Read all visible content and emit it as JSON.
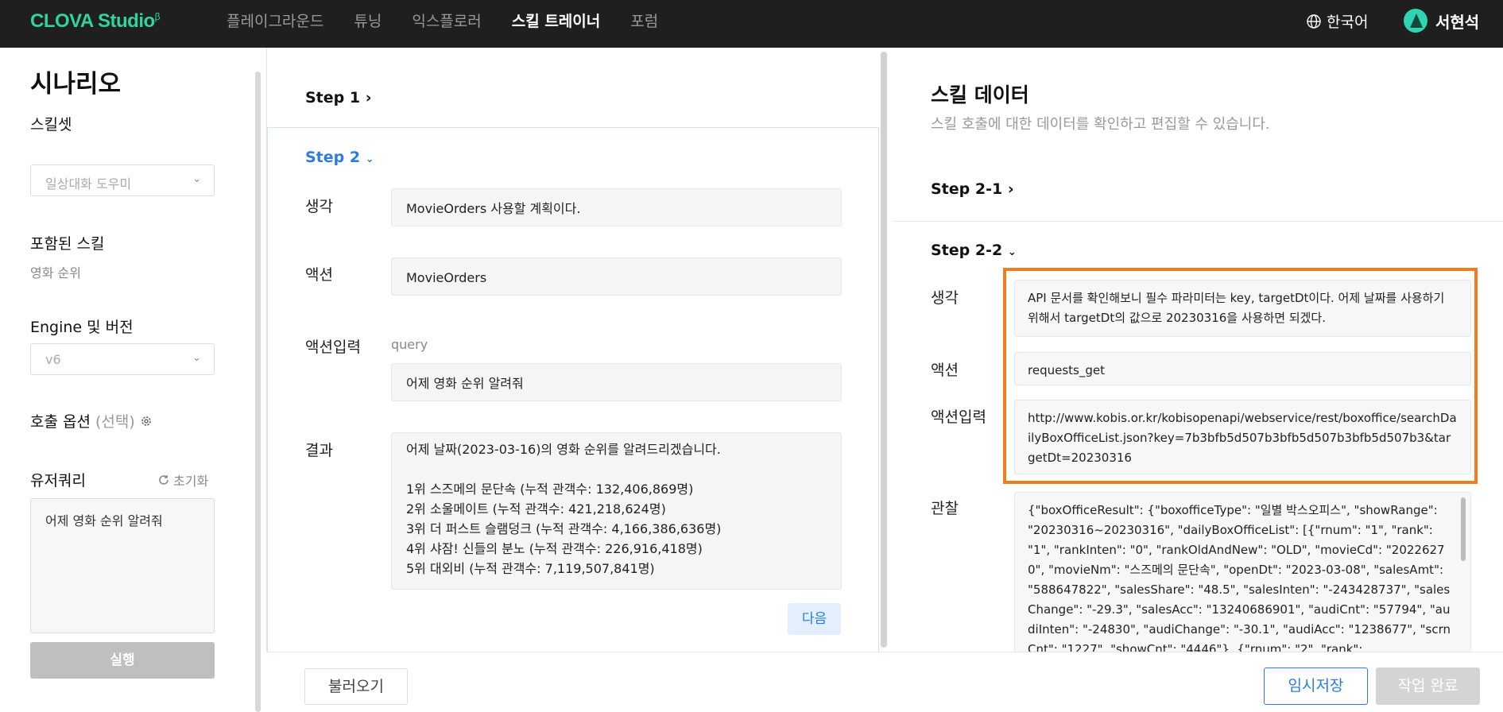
{
  "brand": {
    "name": "CLOVA Studio",
    "beta": "β"
  },
  "nav": {
    "items": [
      "플레이그라운드",
      "튜닝",
      "익스플로러",
      "스킬 트레이너",
      "포럼"
    ],
    "active_index": 3
  },
  "header": {
    "language": "한국어",
    "user": "서현석"
  },
  "sidebar": {
    "title": "시나리오",
    "skillset_label": "스킬셋",
    "skillset_value": "일상대화 도우미",
    "included_skills_label": "포함된 스킬",
    "included_skills_value": "영화 순위",
    "engine_label": "Engine 및 버전",
    "engine_value": "v6",
    "call_options_label": "호출 옵션",
    "call_options_note": "(선택)",
    "user_query_label": "유저쿼리",
    "reset_label": "초기화",
    "user_query_value": "어제 영화 순위 알려줘",
    "run_label": "실행"
  },
  "middle": {
    "step1": "Step 1",
    "step2": "Step 2",
    "thought_label": "생각",
    "thought_value": "MovieOrders 사용할 계획이다.",
    "action_label": "액션",
    "action_value": "MovieOrders",
    "action_input_label": "액션입력",
    "action_input_hint": "query",
    "action_input_value": "어제 영화 순위 알려줘",
    "result_label": "결과",
    "result_lines": [
      "어제 날짜(2023-03-16)의 영화 순위를 알려드리겠습니다.",
      "",
      "1위 스즈메의 문단속 (누적 관객수: 132,406,869명)",
      "2위 소울메이트 (누적 관객수: 421,218,624명)",
      "3위 더 퍼스트 슬램덩크 (누적 관객수: 4,166,386,636명)",
      "4위 샤잠! 신들의 분노 (누적 관객수: 226,916,418명)",
      "5위 대외비 (누적 관객수: 7,119,507,841명)"
    ],
    "next_label": "다음"
  },
  "right": {
    "title": "스킬 데이터",
    "subtitle": "스킬 호출에 대한 데이터를 확인하고 편집할 수 있습니다.",
    "step21": "Step 2-1",
    "step22": "Step 2-2",
    "thought_label": "생각",
    "thought_value": "API 문서를 확인해보니 필수 파라미터는 key, targetDt이다. 어제 날짜를 사용하기 위해서 targetDt의 값으로 20230316을 사용하면 되겠다.",
    "action_label": "액션",
    "action_value": "requests_get",
    "action_input_label": "액션입력",
    "action_input_value": "http://www.kobis.or.kr/kobisopenapi/webservice/rest/boxoffice/searchDailyBoxOfficeList.json?key=7b3bfb5d507b3bfb5d507b3bfb5d507b3&targetDt=20230316",
    "observation_label": "관찰",
    "observation_value": "{\"boxOfficeResult\": {\"boxofficeType\": \"일별 박스오피스\", \"showRange\": \"20230316~20230316\", \"dailyBoxOfficeList\": [{\"rnum\": \"1\", \"rank\": \"1\", \"rankInten\": \"0\", \"rankOldAndNew\": \"OLD\", \"movieCd\": \"20226270\", \"movieNm\": \"스즈메의 문단속\", \"openDt\": \"2023-03-08\", \"salesAmt\": \"588647822\", \"salesShare\": \"48.5\", \"salesInten\": \"-243428737\", \"salesChange\": \"-29.3\", \"salesAcc\": \"13240686901\", \"audiCnt\": \"57794\", \"audiInten\": \"-24830\", \"audiChange\": \"-30.1\", \"audiAcc\": \"1238677\", \"scrnCnt\": \"1227\", \"showCnt\": \"4446\"}, {\"rnum\": \"2\", \"rank\":"
  },
  "footer": {
    "load_label": "불러오기",
    "save_label": "임시저장",
    "done_label": "작업 완료"
  },
  "colors": {
    "accent": "#2a7be4",
    "brand": "#2ed59c",
    "highlight": "#f07c1e"
  }
}
